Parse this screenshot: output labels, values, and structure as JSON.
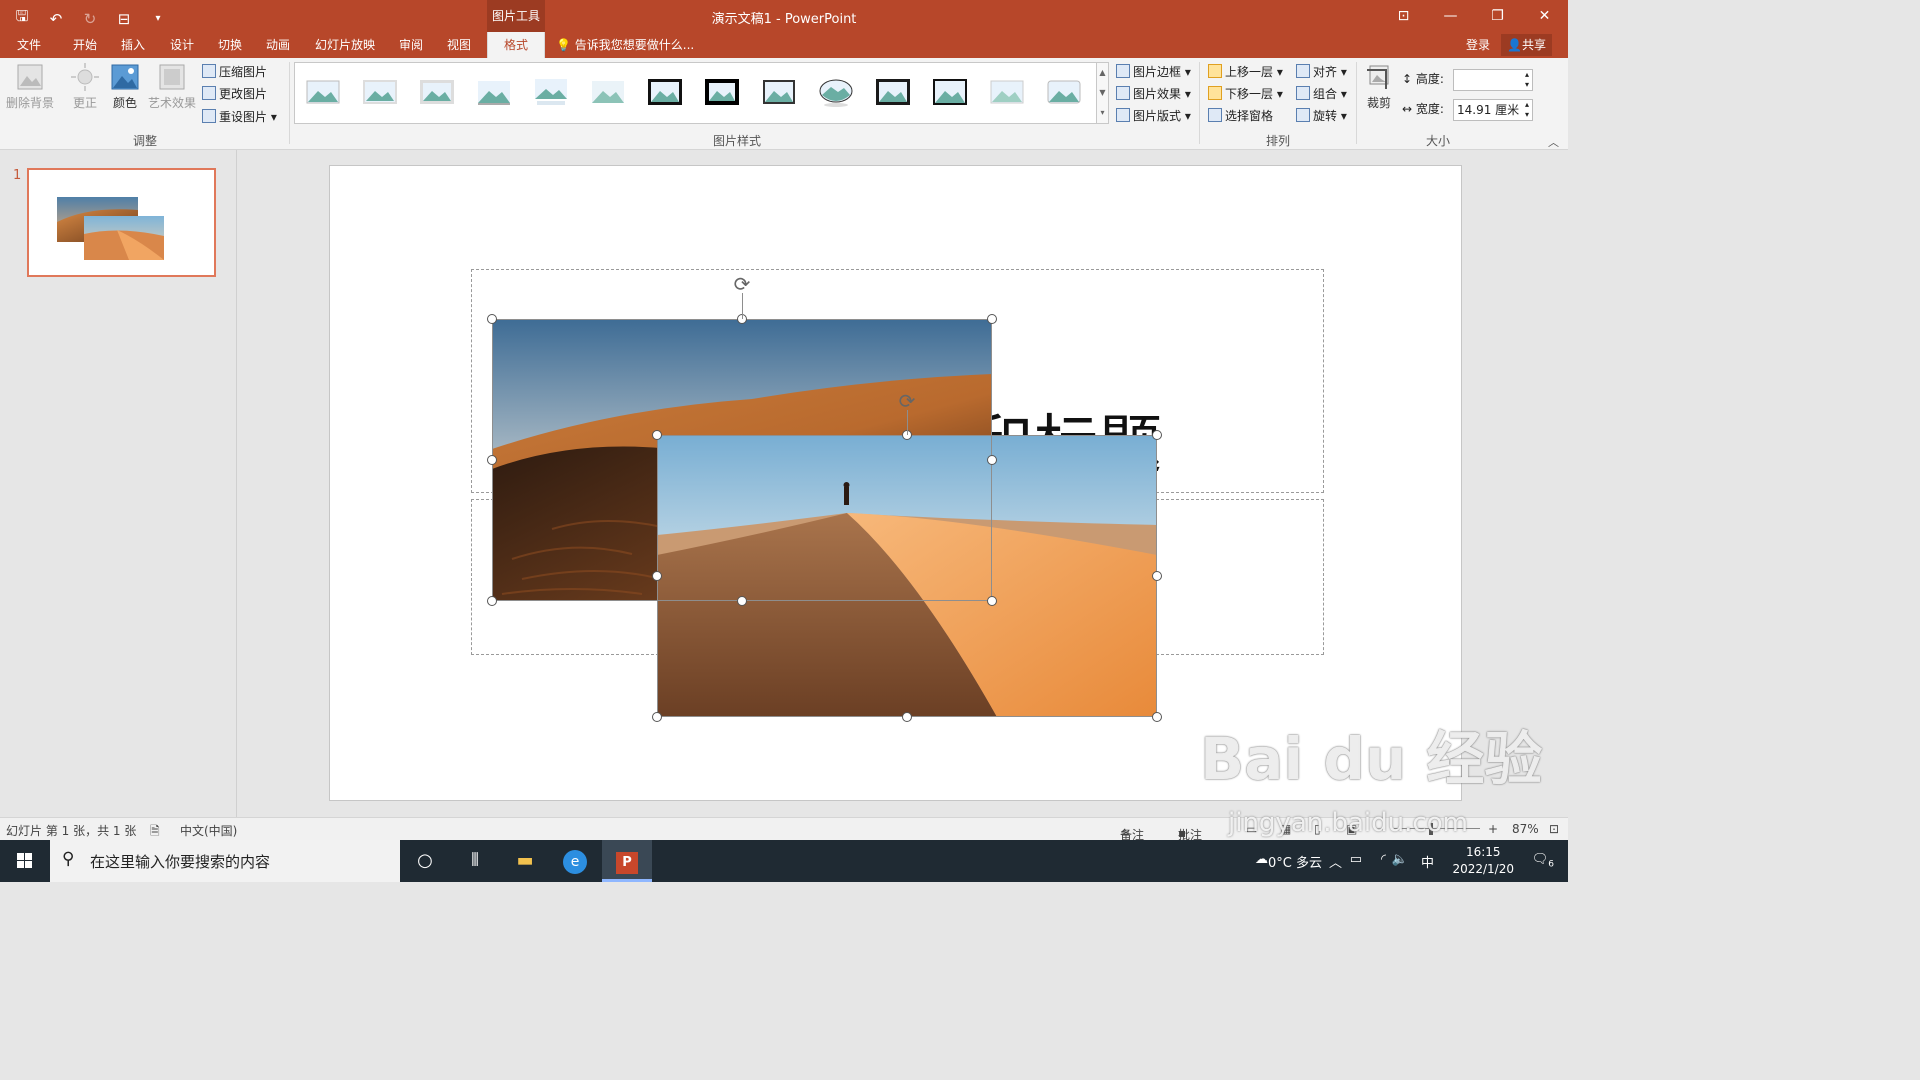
{
  "window": {
    "title": "演示文稿1 - PowerPoint",
    "context_tools_label": "图片工具",
    "controls": [
      "⊡",
      "—",
      "❐",
      "✕"
    ]
  },
  "qat": {
    "save": "🖫",
    "undo": "↶",
    "redo": "↻",
    "present": "⊟",
    "more": "▾"
  },
  "tabs": [
    {
      "label": "文件"
    },
    {
      "label": "开始"
    },
    {
      "label": "插入"
    },
    {
      "label": "设计"
    },
    {
      "label": "切换"
    },
    {
      "label": "动画"
    },
    {
      "label": "幻灯片放映"
    },
    {
      "label": "审阅"
    },
    {
      "label": "视图"
    },
    {
      "label": "格式",
      "active": true
    }
  ],
  "tellme": "告诉我您想要做什么...",
  "account": {
    "login": "登录",
    "share": "共享"
  },
  "ribbon": {
    "adjust": {
      "remove_bg": "删除背景",
      "corrections": "更正",
      "color": "颜色",
      "artistic": "艺术效果",
      "compress": "压缩图片",
      "change": "更改图片",
      "reset": "重设图片",
      "label": "调整"
    },
    "styles": {
      "border": "图片边框",
      "effects": "图片效果",
      "layout": "图片版式",
      "label": "图片样式"
    },
    "arrange": {
      "bring_forward": "上移一层",
      "send_backward": "下移一层",
      "selection_pane": "选择窗格",
      "align": "对齐",
      "group": "组合",
      "rotate": "旋转",
      "label": "排列"
    },
    "size": {
      "crop": "裁剪",
      "height_label": "高度:",
      "height_value": "",
      "width_label": "宽度:",
      "width_value": "14.91 厘米",
      "label": "大小"
    }
  },
  "slides_panel": {
    "slide_number": "1"
  },
  "slide": {
    "title_partial": "和标题"
  },
  "statusbar": {
    "slide_info": "幻灯片 第 1 张，共 1 张",
    "language": "中文(中国)",
    "notes": "备注",
    "comments": "批注",
    "zoom": "87%"
  },
  "taskbar": {
    "search_placeholder": "在这里输入你要搜索的内容",
    "weather": "0°C 多云",
    "ime": "中",
    "time": "16:15",
    "date": "2022/1/20",
    "notifications": "6"
  },
  "watermark": {
    "text": "Bai du 经验",
    "url": "jingyan.baidu.com"
  },
  "colors": {
    "accent": "#b7472a",
    "selection": "#e0785a"
  }
}
